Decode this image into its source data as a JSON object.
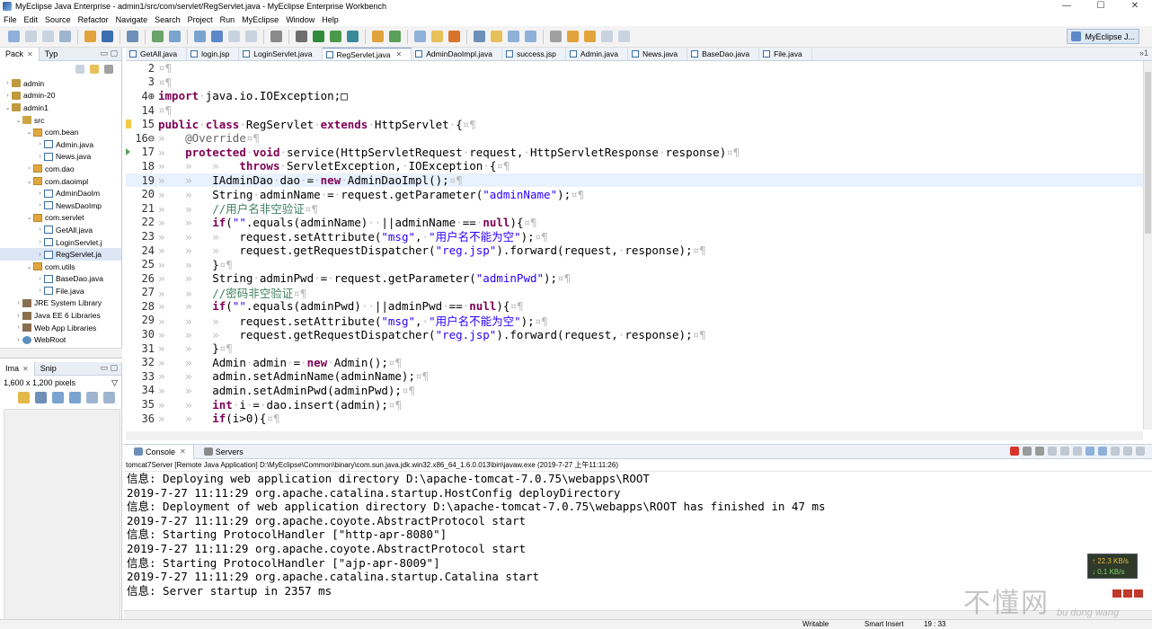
{
  "window": {
    "title": "MyEclipse Java Enterprise - admin1/src/com/servlet/RegServlet.java - MyEclipse Enterprise Workbench",
    "minimize": "—",
    "maximize": "☐",
    "close": "✕"
  },
  "menu": [
    "File",
    "Edit",
    "Source",
    "Refactor",
    "Navigate",
    "Search",
    "Project",
    "Run",
    "MyEclipse",
    "Window",
    "Help"
  ],
  "perspective": "MyEclipse J...",
  "explorer": {
    "tabs": [
      {
        "label": "Pack"
      },
      {
        "label": "Typ"
      }
    ],
    "tree": [
      {
        "label": "admin",
        "depth": 0,
        "icon": "project",
        "arrow": "›"
      },
      {
        "label": "admin-20",
        "depth": 0,
        "icon": "project",
        "arrow": "›"
      },
      {
        "label": "admin1",
        "depth": 0,
        "icon": "project",
        "arrow": "⌄"
      },
      {
        "label": "src",
        "depth": 1,
        "icon": "src",
        "arrow": "⌄"
      },
      {
        "label": "com.bean",
        "depth": 2,
        "icon": "pkg",
        "arrow": "⌄"
      },
      {
        "label": "Admin.java",
        "depth": 3,
        "icon": "java",
        "arrow": "›"
      },
      {
        "label": "News.java",
        "depth": 3,
        "icon": "java",
        "arrow": "›"
      },
      {
        "label": "com.dao",
        "depth": 2,
        "icon": "pkg",
        "arrow": "›"
      },
      {
        "label": "com.daoimpl",
        "depth": 2,
        "icon": "pkg",
        "arrow": "⌄"
      },
      {
        "label": "AdminDaoIm",
        "depth": 3,
        "icon": "java",
        "arrow": "›"
      },
      {
        "label": "NewsDaoImp",
        "depth": 3,
        "icon": "java",
        "arrow": "›"
      },
      {
        "label": "com.servlet",
        "depth": 2,
        "icon": "pkg",
        "arrow": "⌄"
      },
      {
        "label": "GetAll.java",
        "depth": 3,
        "icon": "java",
        "arrow": "›"
      },
      {
        "label": "LoginServlet.j",
        "depth": 3,
        "icon": "java",
        "arrow": "›"
      },
      {
        "label": "RegServlet.ja",
        "depth": 3,
        "icon": "java",
        "arrow": "›",
        "selected": true
      },
      {
        "label": "com.utils",
        "depth": 2,
        "icon": "pkg",
        "arrow": "⌄"
      },
      {
        "label": "BaseDao.java",
        "depth": 3,
        "icon": "java",
        "arrow": "›"
      },
      {
        "label": "File.java",
        "depth": 3,
        "icon": "java",
        "arrow": "›"
      },
      {
        "label": "JRE System Library",
        "depth": 1,
        "icon": "lib",
        "arrow": "›"
      },
      {
        "label": "Java EE 6 Libraries",
        "depth": 1,
        "icon": "lib",
        "arrow": "›"
      },
      {
        "label": "Web App Libraries",
        "depth": 1,
        "icon": "lib",
        "arrow": "›"
      },
      {
        "label": "WebRoot",
        "depth": 1,
        "icon": "web",
        "arrow": "›"
      }
    ]
  },
  "image_panel": {
    "tabs": [
      {
        "label": "Ima"
      },
      {
        "label": "Snip"
      }
    ],
    "size": "1,600 x 1,200 pixels"
  },
  "editor": {
    "tabs": [
      {
        "label": "GetAll.java"
      },
      {
        "label": "login.jsp"
      },
      {
        "label": "LoginServlet.java"
      },
      {
        "label": "RegServlet.java",
        "active": true
      },
      {
        "label": "AdminDaoImpl.java"
      },
      {
        "label": "success.jsp"
      },
      {
        "label": "Admin.java"
      },
      {
        "label": "News.java"
      },
      {
        "label": "BaseDao.java"
      },
      {
        "label": "File.java"
      }
    ],
    "overflow": "»1",
    "lines": [
      {
        "n": "2",
        "text": "¤¶"
      },
      {
        "n": "3",
        "text": "¤¶"
      },
      {
        "n": "4⊕",
        "text": "import·java.io.IOException;□"
      },
      {
        "n": "14",
        "text": "¤¶"
      },
      {
        "n": "15",
        "text": "public·class·RegServlet·extends·HttpServlet·{¤¶",
        "marker": "warn"
      },
      {
        "n": "16⊖",
        "text": "»   @Override¤¶"
      },
      {
        "n": "17",
        "text": "»   protected·void·service(HttpServletRequest·request,·HttpServletResponse·response)¤¶",
        "marker": "tri"
      },
      {
        "n": "18",
        "text": "»   »   »   throws·ServletException,·IOException·{¤¶"
      },
      {
        "n": "19",
        "text": "»   »   IAdminDao·dao·=·new·AdminDaoImpl();¤¶",
        "current": true
      },
      {
        "n": "20",
        "text": "»   »   String·adminName·=·request.getParameter(\"adminName\");¤¶"
      },
      {
        "n": "21",
        "text": "»   »   //用户名非空验证¤¶"
      },
      {
        "n": "22",
        "text": "»   »   if(\"\".equals(adminName)··||adminName·==·null){¤¶"
      },
      {
        "n": "23",
        "text": "»   »   »   request.setAttribute(\"msg\",·\"用户名不能为空\");¤¶"
      },
      {
        "n": "24",
        "text": "»   »   »   request.getRequestDispatcher(\"reg.jsp\").forward(request,·response);¤¶"
      },
      {
        "n": "25",
        "text": "»   »   }¤¶"
      },
      {
        "n": "26",
        "text": "»   »   String·adminPwd·=·request.getParameter(\"adminPwd\");¤¶"
      },
      {
        "n": "27",
        "text": "»   »   //密码非空验证¤¶"
      },
      {
        "n": "28",
        "text": "»   »   if(\"\".equals(adminPwd)··||adminPwd·==·null){¤¶"
      },
      {
        "n": "29",
        "text": "»   »   »   request.setAttribute(\"msg\",·\"用户名不能为空\");¤¶"
      },
      {
        "n": "30",
        "text": "»   »   »   request.getRequestDispatcher(\"reg.jsp\").forward(request,·response);¤¶"
      },
      {
        "n": "31",
        "text": "»   »   }¤¶"
      },
      {
        "n": "32",
        "text": "»   »   Admin·admin·=·new·Admin();¤¶"
      },
      {
        "n": "33",
        "text": "»   »   admin.setAdminName(adminName);¤¶"
      },
      {
        "n": "34",
        "text": "»   »   admin.setAdminPwd(adminPwd);¤¶"
      },
      {
        "n": "35",
        "text": "»   »   int·i·=·dao.insert(admin);¤¶"
      },
      {
        "n": "36",
        "text": "»   »   if(i>0){¤¶"
      }
    ]
  },
  "console": {
    "tabs": [
      {
        "label": "Console"
      },
      {
        "label": "Servers"
      }
    ],
    "description": "tomcat7Server [Remote Java Application] D:\\MyEclipse\\Common\\binary\\com.sun.java.jdk.win32.x86_64_1.6.0.013\\bin\\javaw.exe (2019-7-27 上午11:11:26)",
    "lines": [
      "信息: Deploying web application directory D:\\apache-tomcat-7.0.75\\webapps\\ROOT",
      "2019-7-27 11:11:29 org.apache.catalina.startup.HostConfig deployDirectory",
      "信息: Deployment of web application directory D:\\apache-tomcat-7.0.75\\webapps\\ROOT has finished in 47 ms",
      "2019-7-27 11:11:29 org.apache.coyote.AbstractProtocol start",
      "信息: Starting ProtocolHandler [\"http-apr-8080\"]",
      "2019-7-27 11:11:29 org.apache.coyote.AbstractProtocol start",
      "信息: Starting ProtocolHandler [\"ajp-apr-8009\"]",
      "2019-7-27 11:11:29 org.apache.catalina.startup.Catalina start",
      "信息: Server startup in 2357 ms"
    ]
  },
  "status": {
    "writable": "Writable",
    "insert": "Smart Insert",
    "position": "19 : 33"
  },
  "network": {
    "up": "↑ 22.3 KB/s",
    "down": "↓ 0.1 KB/s"
  },
  "watermark": {
    "main": "不懂网",
    "sub": "bu dong wang"
  },
  "colors": {
    "keyword": "#7f0055",
    "string": "#2a00ff",
    "comment": "#3f7f5f",
    "annotation": "#646464",
    "whitespace": "#bbbbbb"
  }
}
